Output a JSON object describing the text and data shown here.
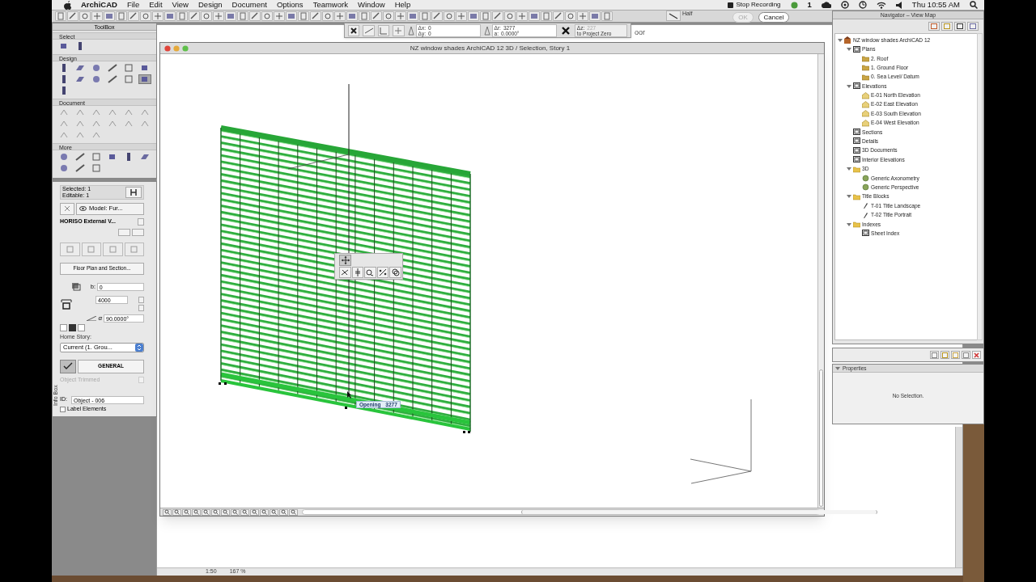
{
  "menu_bar": {
    "app": "ArchiCAD",
    "menus": [
      "File",
      "Edit",
      "View",
      "Design",
      "Document",
      "Options",
      "Teamwork",
      "Window",
      "Help"
    ],
    "recording": "Stop Recording",
    "status_text": "1",
    "clock": "Thu 10:55 AM"
  },
  "toolbar": {
    "half_label": "Half",
    "ok": {
      "label": "OK",
      "disabled": true
    },
    "cancel": {
      "label": "Cancel",
      "disabled": false
    }
  },
  "coordinate_bar": {
    "fields": [
      {
        "label": "Δx:",
        "value": "0"
      },
      {
        "label": "Δy:",
        "value": "0"
      },
      {
        "label": "Δr:",
        "value": "3277"
      },
      {
        "label": "a:",
        "value": "0.0000°"
      },
      {
        "label": "Δz:",
        "value": "227"
      }
    ],
    "reference": "to Project Zero"
  },
  "background_window": {
    "title_fragment": "oor",
    "scale": "1:50",
    "zoom": "167 %"
  },
  "toolbox": {
    "title": "ToolBox",
    "sections": [
      {
        "title": "Select",
        "tools": [
          {
            "selected": false
          },
          {
            "selected": false
          }
        ]
      },
      {
        "title": "Design",
        "tools": [
          {
            "selected": false
          },
          {
            "selected": false
          },
          {
            "selected": false
          },
          {
            "selected": false
          },
          {
            "selected": false
          },
          {
            "selected": false
          },
          {
            "selected": false
          },
          {
            "selected": false
          },
          {
            "selected": false
          },
          {
            "selected": false
          },
          {
            "selected": false
          },
          {
            "selected": true
          },
          {
            "selected": false
          }
        ]
      },
      {
        "title": "Document",
        "tools": [
          {
            "selected": false
          },
          {
            "selected": false
          },
          {
            "selected": false
          },
          {
            "selected": false
          },
          {
            "selected": false
          },
          {
            "selected": false
          },
          {
            "selected": false
          },
          {
            "selected": false
          },
          {
            "selected": false
          },
          {
            "selected": false
          },
          {
            "selected": false
          },
          {
            "selected": false
          },
          {
            "selected": false
          },
          {
            "selected": false
          },
          {
            "selected": false
          }
        ]
      },
      {
        "title": "More",
        "tools": [
          {
            "selected": false
          },
          {
            "selected": false
          },
          {
            "selected": false
          },
          {
            "selected": false
          },
          {
            "selected": false
          },
          {
            "selected": false
          },
          {
            "selected": false
          },
          {
            "selected": false
          },
          {
            "selected": false
          }
        ]
      }
    ]
  },
  "info_box": {
    "side_label": "Info Box",
    "selected": "Selected: 1",
    "editable": "Editable: 1",
    "layer": "Model: Fur...",
    "object_name": "HORISO External V...",
    "settings_button": "Floor Plan and Section...",
    "offset_label": "b:",
    "offset_value": "0",
    "height_value": "4000",
    "angle_label": "α",
    "angle_value": "90.0000°",
    "home_story_label": "Home Story:",
    "home_story": "Current (1. Grou...",
    "parameters": "GENERAL",
    "trimmed": {
      "label": "Object Trimmed",
      "disabled": true
    },
    "id_label": "ID:",
    "id_value": "Object - 006",
    "label_elements": {
      "label": "Label Elements",
      "checked": false
    }
  },
  "main_window": {
    "title": "NZ window shades ArchiCAD 12 3D / Selection, Story 1",
    "dimension": {
      "label": "Opening",
      "value": "3277"
    }
  },
  "navigator": {
    "title": "Navigator – View Map",
    "tree": [
      {
        "label": "NZ window shades ArchiCAD 12",
        "kind": "project",
        "expanded": true,
        "children": [
          {
            "label": "Plans",
            "kind": "plans",
            "expanded": true,
            "children": [
              {
                "label": "2. Roof",
                "kind": "story"
              },
              {
                "label": "1. Ground Floor",
                "kind": "story"
              },
              {
                "label": "0. Sea Level/ Datum",
                "kind": "story"
              }
            ]
          },
          {
            "label": "Elevations",
            "kind": "plans",
            "expanded": true,
            "children": [
              {
                "label": "E-01 North Elevation",
                "kind": "elevation"
              },
              {
                "label": "E-02 East Elevation",
                "kind": "elevation"
              },
              {
                "label": "E-03 South Elevation",
                "kind": "elevation"
              },
              {
                "label": "E-04 West Elevation",
                "kind": "elevation"
              }
            ]
          },
          {
            "label": "Sections",
            "kind": "plans"
          },
          {
            "label": "Details",
            "kind": "plans"
          },
          {
            "label": "3D Documents",
            "kind": "plans"
          },
          {
            "label": "Interior Elevations",
            "kind": "plans"
          },
          {
            "label": "3D",
            "kind": "folder",
            "expanded": true,
            "children": [
              {
                "label": "Generic Axonometry",
                "kind": "view3d"
              },
              {
                "label": "Generic Perspective",
                "kind": "view3d"
              }
            ]
          },
          {
            "label": "Title Blocks",
            "kind": "folder",
            "expanded": true,
            "children": [
              {
                "label": "T-01 Title Landscape",
                "kind": "layout"
              },
              {
                "label": "T-02 Title Portrait",
                "kind": "layout"
              }
            ]
          },
          {
            "label": "Indexes",
            "kind": "folder",
            "expanded": true,
            "children": [
              {
                "label": "Sheet Index",
                "kind": "plans"
              }
            ]
          }
        ]
      }
    ]
  },
  "properties": {
    "title": "Properties",
    "message": "No Selection."
  }
}
